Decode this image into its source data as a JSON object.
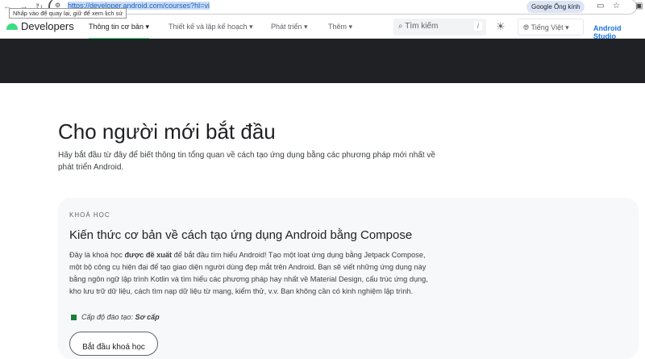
{
  "browser": {
    "url": "https://developer.android.com/courses?hl=vi",
    "tooltip": "Nhấp vào để quay lại, giữ để xem lịch sử",
    "lens": "Google Ống kính"
  },
  "nav": {
    "logo": "Developers",
    "tabs": [
      "Thông tin cơ bản",
      "Thiết kế và lập kế hoạch",
      "Phát triển",
      "Thêm"
    ],
    "search_placeholder": "Tìm kiếm",
    "search_shortcut": "/",
    "language": "Tiếng Việt",
    "studio": "Android Studio"
  },
  "page": {
    "title": "Cho người mới bắt đầu",
    "intro": "Hãy bắt đầu từ đây để biết thông tin tổng quan về cách tạo ứng dụng bằng các phương pháp mới nhất về phát triển Android."
  },
  "card": {
    "kicker": "KHOÁ HỌC",
    "title": "Kiến thức cơ bản về cách tạo ứng dụng Android bằng Compose",
    "desc_pre": "Đây là khoá học ",
    "desc_bold": "được đề xuất",
    "desc_post": " để bắt đầu tìm hiểu Android! Tạo một loạt ứng dụng bằng Jetpack Compose, một bộ công cụ hiện đại để tạo giao diện người dùng đẹp mắt trên Android. Bạn sẽ viết những ứng dụng này bằng ngôn ngữ lập trình Kotlin và tìm hiểu các phương pháp hay nhất về Material Design, cấu trúc ứng dụng, kho lưu trữ dữ liệu, cách tìm nạp dữ liệu từ mạng, kiểm thử, v.v. Bạn không cần có kinh nghiệm lập trình.",
    "level_label": "Cấp độ đào tạo: ",
    "level_value": "Sơ cấp",
    "button": "Bắt đầu khoá học"
  }
}
